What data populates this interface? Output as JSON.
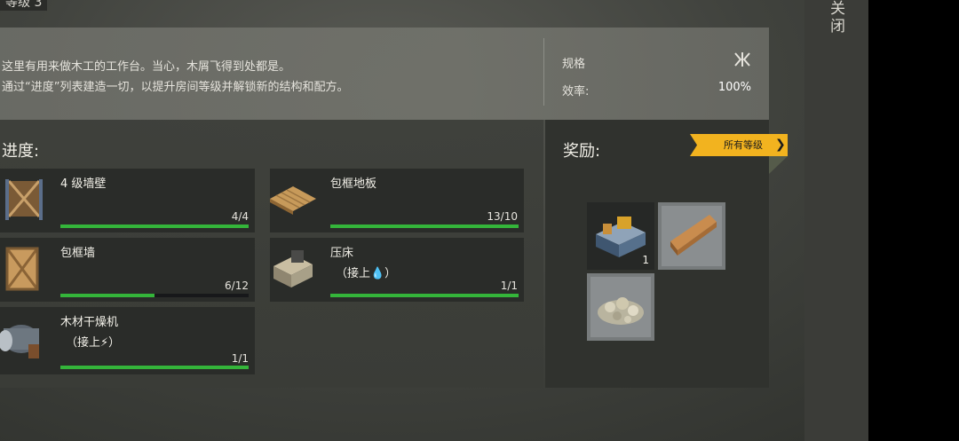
{
  "header": {
    "level_label": "等级 3"
  },
  "description": {
    "line1": "这里有用来做木工的工作台。当心，木屑飞得到处都是。",
    "line2": "通过“进度”列表建造一切，以提升房间等级并解锁新的结构和配方。"
  },
  "specs": {
    "spec_label": "规格",
    "spec_icon": "arrows-icon",
    "efficiency_label": "效率:",
    "efficiency_value": "100%"
  },
  "progress": {
    "title": "进度:",
    "items": [
      {
        "name": "4 级墙壁",
        "sub": "",
        "count": "4/4",
        "fill": 1.0
      },
      {
        "name": "包框地板",
        "sub": "",
        "count": "13/10",
        "fill": 1.0
      },
      {
        "name": "包框墙",
        "sub": "",
        "count": "6/12",
        "fill": 0.5
      },
      {
        "name": "压床",
        "sub": "（接上💧）",
        "count": "1/1",
        "fill": 1.0
      },
      {
        "name": "木材干燥机",
        "sub": "（接上⚡）",
        "count": "1/1",
        "fill": 1.0
      }
    ]
  },
  "rewards": {
    "title": "奖励:",
    "all_levels_button": "所有等级",
    "slots": [
      {
        "icon": "workbench-icon",
        "qty": "1"
      },
      {
        "icon": "wood-plank-icon",
        "qty": ""
      },
      {
        "icon": "gravel-pile-icon",
        "qty": ""
      }
    ]
  },
  "side": {
    "close_label": "关闭"
  },
  "colors": {
    "accent": "#f2b31f",
    "progress": "#34b53a"
  }
}
